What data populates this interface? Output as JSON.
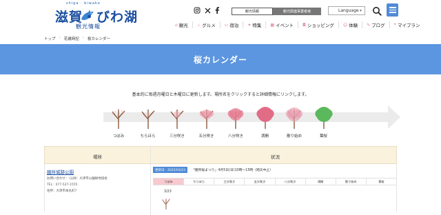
{
  "header": {
    "logo_romaji": "shiga · biwako",
    "logo_main": "滋賀・びわ湖",
    "logo_sub": "観光情報",
    "sns": [
      "instagram-icon",
      "x-icon",
      "facebook-icon"
    ],
    "tab_sightseeing": "観光情報",
    "tab_business": "観光関連事業者様",
    "language_label": "Language",
    "accent_color": "#4f8bd6"
  },
  "gnav": [
    {
      "icon": "house-icon",
      "label": "観光"
    },
    {
      "icon": "gourmet-icon",
      "label": "グルメ"
    },
    {
      "icon": "bed-icon",
      "label": "宿泊"
    },
    {
      "icon": "star-icon",
      "label": "特集"
    },
    {
      "icon": "calendar-icon",
      "label": "イベント"
    },
    {
      "icon": "bag-icon",
      "label": "ショッピング"
    },
    {
      "icon": "person-icon",
      "label": "体験"
    },
    {
      "icon": "pen-icon",
      "label": "ブログ"
    },
    {
      "icon": "map-icon",
      "label": "マイプラン"
    }
  ],
  "breadcrumb": [
    "トップ",
    "花歳時記",
    "桜カレンダー"
  ],
  "banner": {
    "title": "桜カレンダー",
    "color": "#5d96e0"
  },
  "intro": "基本的に毎週月曜日と木曜日に更新します。場所名をクリックすると詳細情報にリンクします。",
  "stages": [
    {
      "label": "つぼみ",
      "bloom": 0
    },
    {
      "label": "ちらほら",
      "bloom": 1
    },
    {
      "label": "三分咲き",
      "bloom": 2
    },
    {
      "label": "五分咲き",
      "bloom": 3
    },
    {
      "label": "八分咲き",
      "bloom": 4
    },
    {
      "label": "満開",
      "bloom": 5
    },
    {
      "label": "散り始め",
      "bloom": 6
    },
    {
      "label": "葉桜",
      "bloom": 7
    }
  ],
  "table": {
    "col_place": "場所",
    "col_status": "状況",
    "rows": [
      {
        "place": "膳所城跡公園",
        "info": [
          "お問い合わせ：（公財）大津市公園緑地協会",
          "TEL：077-527-1555",
          "住所：大津市本丸町7"
        ],
        "updated": "更新日：2025/03/23",
        "event": "「膳所桜まつり」4月5日(日)10時～15時（雨天中止）",
        "status_cells": [
          "つぼみ",
          "ちらほら",
          "三分咲き",
          "五分咲き",
          "八分咲き",
          "満開",
          "散り始め",
          "葉桜"
        ],
        "active_status": 0,
        "date": "3/23"
      }
    ]
  }
}
